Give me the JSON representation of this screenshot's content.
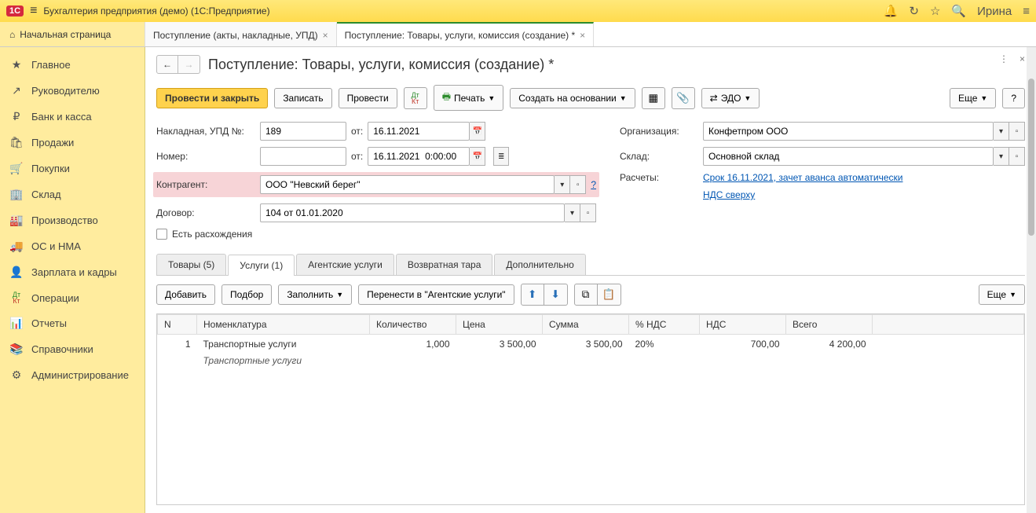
{
  "titlebar": {
    "app_name": "Бухгалтерия предприятия (демо)  (1С:Предприятие)",
    "user": "Ирина"
  },
  "tabs": {
    "home": "Начальная страница",
    "tab1": "Поступление (акты, накладные, УПД)",
    "tab2": "Поступление: Товары, услуги, комиссия (создание) *"
  },
  "sidebar": {
    "items": [
      {
        "icon": "★",
        "label": "Главное"
      },
      {
        "icon": "↗",
        "label": "Руководителю"
      },
      {
        "icon": "₽",
        "label": "Банк и касса"
      },
      {
        "icon": "🛍",
        "label": "Продажи"
      },
      {
        "icon": "🛒",
        "label": "Покупки"
      },
      {
        "icon": "🏢",
        "label": "Склад"
      },
      {
        "icon": "🏭",
        "label": "Производство"
      },
      {
        "icon": "🚚",
        "label": "ОС и НМА"
      },
      {
        "icon": "👤",
        "label": "Зарплата и кадры"
      },
      {
        "icon": "Дт",
        "label": "Операции"
      },
      {
        "icon": "📊",
        "label": "Отчеты"
      },
      {
        "icon": "📚",
        "label": "Справочники"
      },
      {
        "icon": "⚙",
        "label": "Администрирование"
      }
    ]
  },
  "page": {
    "title": "Поступление: Товары, услуги, комиссия (создание) *",
    "toolbar": {
      "post_close": "Провести и закрыть",
      "save": "Записать",
      "post": "Провести",
      "print": "Печать",
      "create_based": "Создать на основании",
      "edo": "ЭДО",
      "more": "Еще",
      "help": "?"
    },
    "form": {
      "invoice_label": "Накладная, УПД №:",
      "invoice_no": "189",
      "from_label": "от:",
      "invoice_date": "16.11.2021",
      "number_label": "Номер:",
      "number_value": "",
      "doc_date": "16.11.2021  0:00:00",
      "contractor_label": "Контрагент:",
      "contractor": "ООО \"Невский берег\"",
      "contractor_help": "?",
      "contract_label": "Договор:",
      "contract": "104 от 01.01.2020",
      "discrepancy": "Есть расхождения",
      "org_label": "Организация:",
      "org": "Конфетпром ООО",
      "warehouse_label": "Склад:",
      "warehouse": "Основной склад",
      "settlements_label": "Расчеты:",
      "settlements_link": "Срок 16.11.2021, зачет аванса автоматически",
      "vat_link": "НДС сверху"
    },
    "subtabs": {
      "goods": "Товары (5)",
      "services": "Услуги (1)",
      "agent": "Агентские услуги",
      "returnable": "Возвратная тара",
      "extra": "Дополнительно"
    },
    "subtoolbar": {
      "add": "Добавить",
      "pick": "Подбор",
      "fill": "Заполнить",
      "move_agent": "Перенести в \"Агентские услуги\"",
      "more": "Еще"
    },
    "table": {
      "headers": {
        "n": "N",
        "nomenclature": "Номенклатура",
        "qty": "Количество",
        "price": "Цена",
        "sum": "Сумма",
        "vat_pct": "% НДС",
        "vat": "НДС",
        "total": "Всего"
      },
      "row": {
        "n": "1",
        "nomenclature": "Транспортные услуги",
        "nomenclature_sub": "Транспортные услуги",
        "qty": "1,000",
        "price": "3 500,00",
        "sum": "3 500,00",
        "vat_pct": "20%",
        "vat": "700,00",
        "total": "4 200,00"
      }
    }
  }
}
